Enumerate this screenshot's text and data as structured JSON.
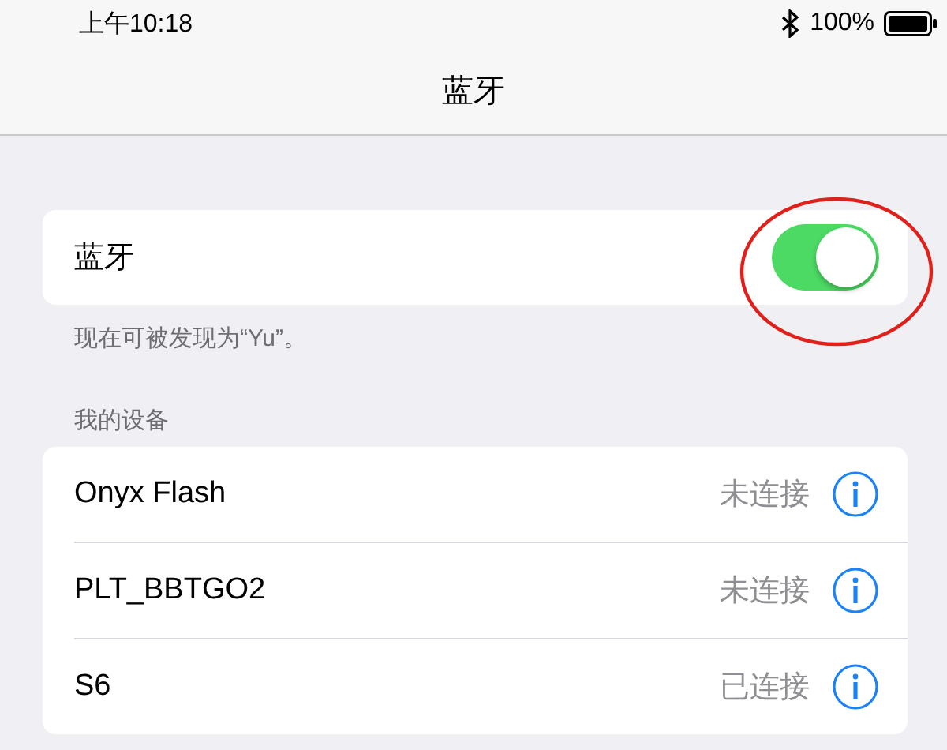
{
  "status_bar": {
    "time": "上午10:18",
    "battery": "100%"
  },
  "nav": {
    "title": "蓝牙"
  },
  "bluetooth": {
    "label": "蓝牙",
    "on": true,
    "footer": "现在可被发现为“Yu”。"
  },
  "devices": {
    "header": "我的设备",
    "items": [
      {
        "name": "Onyx Flash",
        "status": "未连接"
      },
      {
        "name": "PLT_BBTGO2",
        "status": "未连接"
      },
      {
        "name": "S6",
        "status": "已连接"
      }
    ]
  }
}
